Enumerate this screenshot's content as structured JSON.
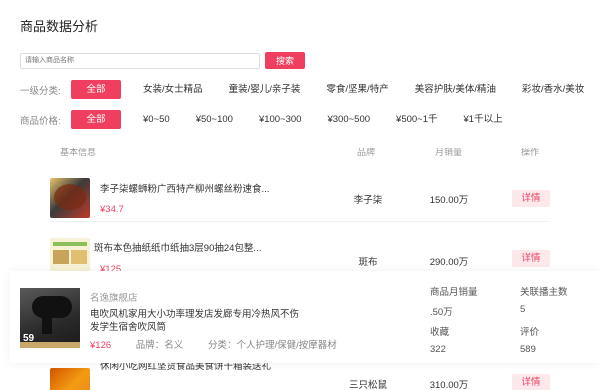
{
  "page_title": "商品数据分析",
  "search": {
    "placeholder": "请输入商品名称",
    "button_label": "搜索"
  },
  "category_filter": {
    "label": "一级分类:",
    "options": [
      "全部",
      "女装/女士精品",
      "童装/婴儿/亲子装",
      "零食/坚果/特产",
      "美容护肤/美体/精油",
      "彩妆/香水/美妆"
    ],
    "selected": "全部"
  },
  "price_filter": {
    "label": "商品价格:",
    "options": [
      "全部",
      "¥0~50",
      "¥50~100",
      "¥100~300",
      "¥300~500",
      "¥500~1千",
      "¥1千以上"
    ],
    "selected": "全部"
  },
  "table": {
    "headers": [
      "基本信息",
      "品牌",
      "月销量",
      "操作"
    ],
    "rows": [
      {
        "name": "李子柒螺蛳粉广西特产柳州螺丝粉速食...",
        "price": "¥34.7",
        "brand": "李子柒",
        "sales": "150.00万",
        "action": "详情"
      },
      {
        "name": "斑布本色抽纸纸巾纸抽3层90抽24包整...",
        "price": "¥125",
        "brand": "斑布",
        "sales": "290.00万",
        "action": "详情"
      },
      {
        "name": "",
        "price": "",
        "brand": "",
        "sales": "",
        "action": ""
      },
      {
        "name": "休闲小吃网红坚货食品美食饼干箱装送礼",
        "price": "",
        "brand": "三只松鼠",
        "sales": "310.00万",
        "action": "详情"
      }
    ]
  },
  "popup": {
    "shop": "名逸旗舰店",
    "title": "电吹风机家用大小功率理发店发廊专用冷热风不伤发学生宿舍吹风筒",
    "image_badge": "59",
    "price": "¥126",
    "brand_label": "品牌：名义",
    "category_label": "分类：个人护理/保健/按摩器材",
    "stats": {
      "monthly_sales_label": "商品月销量",
      "monthly_sales_value": ".50万",
      "streamers_label": "关联播主数",
      "streamers_value": "5",
      "favorites_label": "收藏",
      "favorites_value": "322",
      "reviews_label": "评价",
      "reviews_value": "589"
    }
  },
  "colors": {
    "accent": "#f03f5e",
    "accent_light": "#fde9ec"
  }
}
